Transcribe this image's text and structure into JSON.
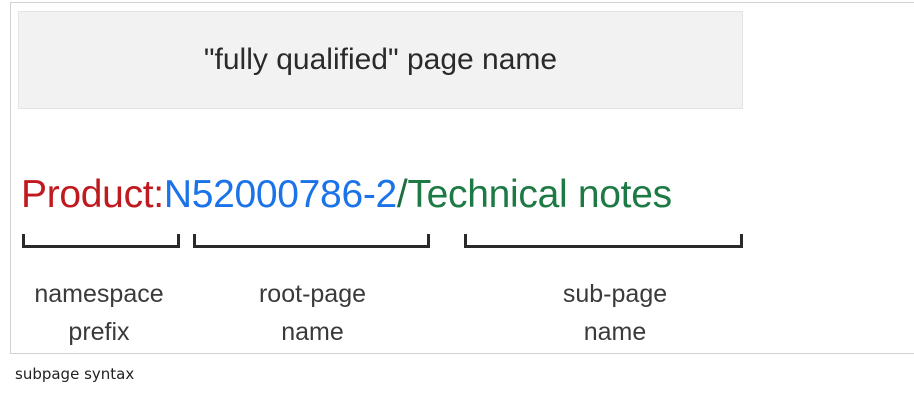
{
  "header": {
    "title": "\"fully qualified\" page name"
  },
  "page_name": {
    "prefix": "Product:",
    "root": "N52000786-2",
    "separator": "/",
    "sub": "Technical notes"
  },
  "labels": {
    "prefix": [
      "namespace",
      "prefix"
    ],
    "root": [
      "root-page",
      "name"
    ],
    "sub": [
      "sub-page",
      "name"
    ]
  },
  "colors": {
    "prefix": "#c0191f",
    "root": "#1a73e8",
    "sub": "#1e7a44",
    "bracket": "#2a2a2a"
  },
  "caption": "subpage syntax"
}
